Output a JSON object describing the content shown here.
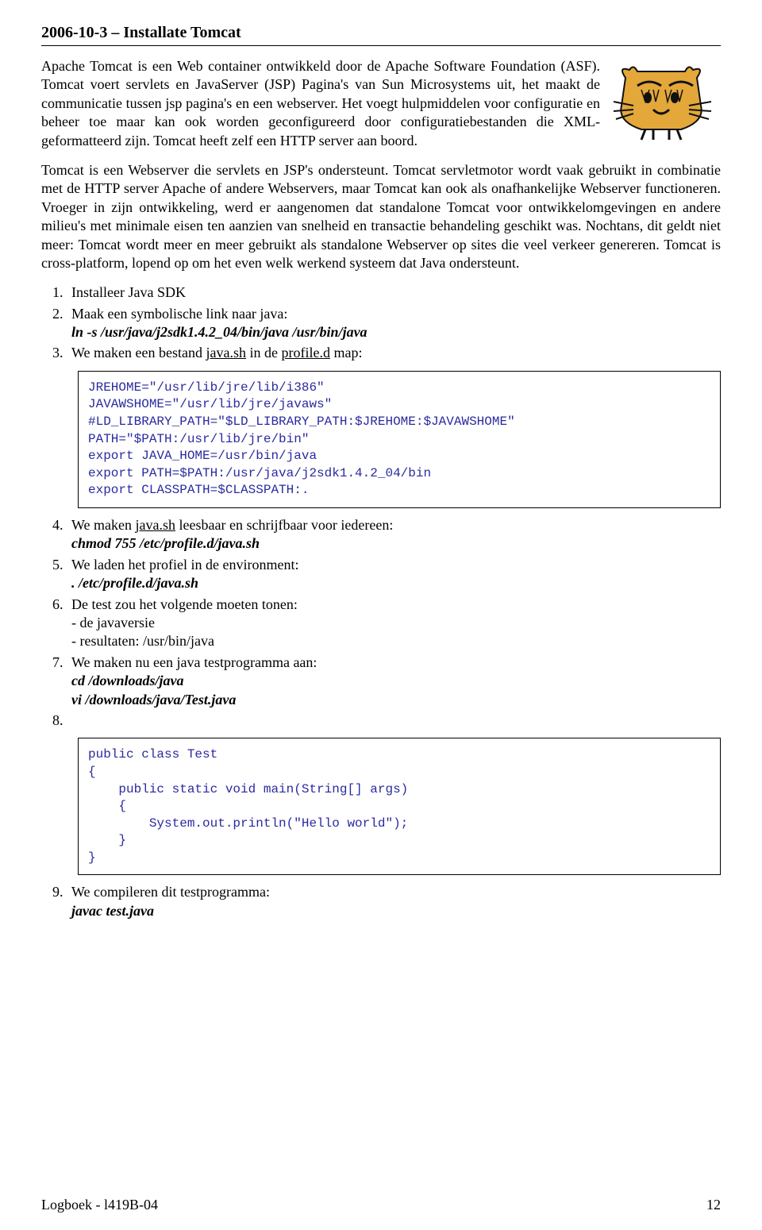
{
  "title": "2006-10-3 – Installate Tomcat",
  "intro_para": "Apache Tomcat is een Web container ontwikkeld door de Apache Software Foundation (ASF). Tomcat voert servlets en JavaServer (JSP) Pagina's van Sun Microsystems uit, het maakt de communicatie tussen jsp pagina's en een webserver. Het voegt hulpmiddelen voor configuratie en beheer toe maar kan ook worden geconfigureerd door configuratiebestanden die XML- geformatteerd zijn. Tomcat heeft zelf een HTTP server aan boord.",
  "para2": "Tomcat is een Webserver die servlets en JSP's ondersteunt. Tomcat servletmotor wordt vaak gebruikt in combinatie met de HTTP server Apache of andere Webservers, maar Tomcat kan ook als onafhankelijke Webserver functioneren. Vroeger in zijn ontwikkeling, werd er aangenomen dat standalone Tomcat voor ontwikkelomgevingen en andere milieu's met minimale eisen ten aanzien van snelheid en transactie behandeling geschikt was. Nochtans, dit geldt niet meer: Tomcat wordt meer en meer gebruikt als standalone Webserver op sites die veel verkeer genereren. Tomcat is cross-platform, lopend op om het even welk werkend systeem dat Java ondersteunt.",
  "steps": {
    "s1": "Installeer Java SDK",
    "s2_pre": "Maak een symbolische link naar java:",
    "s2_cmd": "ln -s /usr/java/j2sdk1.4.2_04/bin/java /usr/bin/java",
    "s3_a": "We maken een bestand ",
    "s3_u1": "java.sh",
    "s3_b": " in de ",
    "s3_u2": "profile.d",
    "s3_c": " map:",
    "code1": "JREHOME=\"/usr/lib/jre/lib/i386\"\nJAVAWSHOME=\"/usr/lib/jre/javaws\"\n#LD_LIBRARY_PATH=\"$LD_LIBRARY_PATH:$JREHOME:$JAVAWSHOME\"\nPATH=\"$PATH:/usr/lib/jre/bin\"\nexport JAVA_HOME=/usr/bin/java\nexport PATH=$PATH:/usr/java/j2sdk1.4.2_04/bin\nexport CLASSPATH=$CLASSPATH:.",
    "s4_a": "We maken ",
    "s4_u": "java.sh",
    "s4_b": " leesbaar en schrijfbaar voor iedereen:",
    "s4_cmd": "chmod 755 /etc/profile.d/java.sh",
    "s5_pre": "We laden het profiel in de environment:",
    "s5_cmd": ". /etc/profile.d/java.sh",
    "s6_pre": "De test zou het volgende moeten tonen:",
    "s6_l1": "- de javaversie",
    "s6_l2": "- resultaten: /usr/bin/java",
    "s7_pre": "We maken nu een java testprogramma aan:",
    "s7_cmd1": "cd /downloads/java",
    "s7_cmd2": "vi /downloads/java/Test.java",
    "s8": "",
    "code2": "public class Test\n{\n    public static void main(String[] args)\n    {\n        System.out.println(\"Hello world\");\n    }\n}",
    "s9_pre": "We compileren dit testprogramma:",
    "s9_cmd": "javac test.java"
  },
  "footer_left": "Logboek - l419B-04",
  "footer_right": "12"
}
